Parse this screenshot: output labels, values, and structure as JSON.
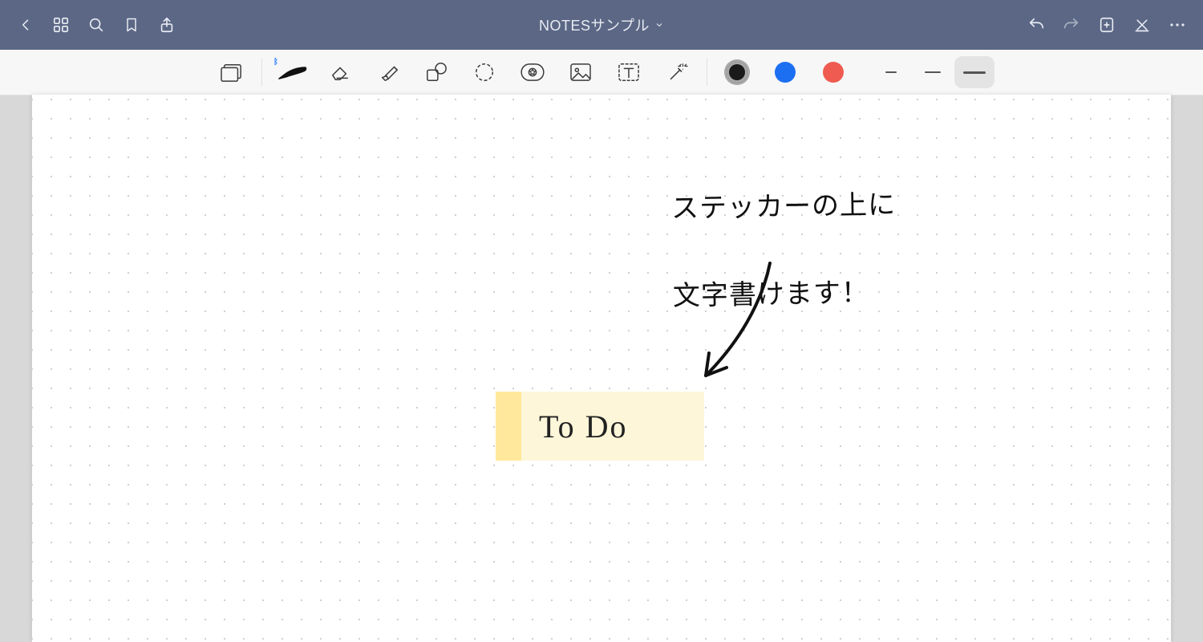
{
  "header": {
    "title": "NOTESサンプル"
  },
  "tools": {
    "bluetooth_badge": "✱"
  },
  "colors": {
    "black": "#1a1a1a",
    "blue": "#1d6ff2",
    "red": "#ef5b50"
  },
  "stroke_widths": {
    "thin": 14,
    "medium": 20,
    "thick": 28
  },
  "canvas": {
    "sticker_text": "To Do",
    "handwriting_line1": "ステッカーの上に",
    "handwriting_line2": "文字書けます！"
  }
}
